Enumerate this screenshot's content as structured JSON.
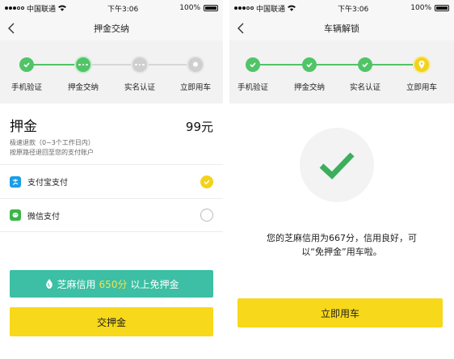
{
  "status_bar": {
    "carrier": "中国联通",
    "time": "下午3:06",
    "battery": "100%"
  },
  "left": {
    "title": "押金交纳",
    "steps": [
      {
        "label": "手机验证",
        "state": "done"
      },
      {
        "label": "押金交纳",
        "state": "current"
      },
      {
        "label": "实名认证",
        "state": "todo"
      },
      {
        "label": "立即用车",
        "state": "todo"
      }
    ],
    "deposit_title": "押金",
    "deposit_amount": "99元",
    "deposit_note_1": "极速退款（0~3个工作日内）",
    "deposit_note_2": "按原路径退回至您的支付账户",
    "pay_options": [
      {
        "label": "支付宝支付",
        "selected": true
      },
      {
        "label": "微信支付",
        "selected": false
      }
    ],
    "zhima_prefix": "芝麻信用",
    "zhima_score": "650分",
    "zhima_suffix": "以上免押金",
    "pay_button": "交押金"
  },
  "right": {
    "title": "车辆解锁",
    "steps": [
      {
        "label": "手机验证",
        "state": "done"
      },
      {
        "label": "押金交纳",
        "state": "done"
      },
      {
        "label": "实名认证",
        "state": "done"
      },
      {
        "label": "立即用车",
        "state": "current"
      }
    ],
    "message_line1": "您的芝麻信用为667分，信用良好，可",
    "message_line2": "以“免押金”用车啦。",
    "use_button": "立即用车"
  },
  "colors": {
    "green": "#52c468",
    "teal": "#3cbfa4",
    "yellow": "#f7d81a",
    "score_highlight": "#f7e14a"
  }
}
